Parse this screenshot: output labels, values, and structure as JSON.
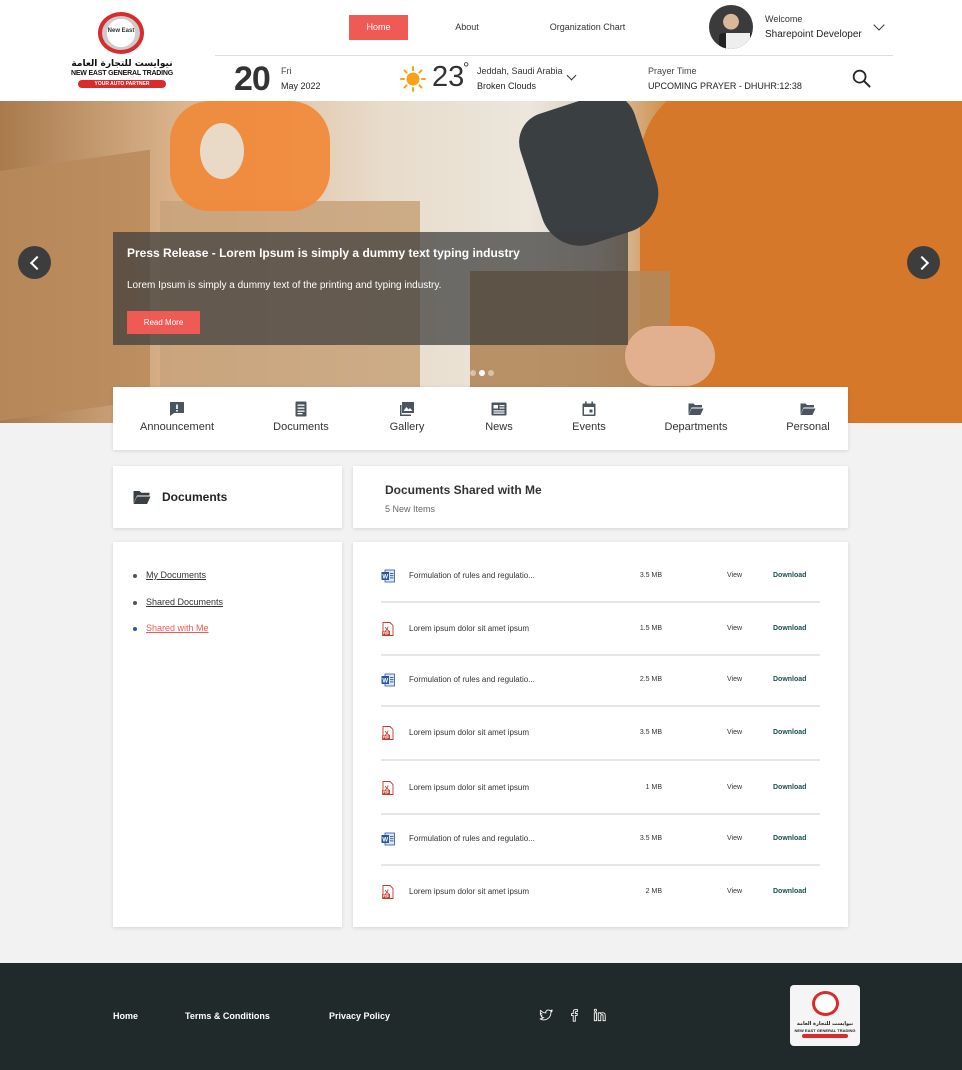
{
  "brand": {
    "arabic_name": "نيوايست للتجارة العامة",
    "english_name": "NEW EAST GENERAL TRADING",
    "tagline": "YOUR AUTO PARTNER",
    "emblem_text": "New East",
    "accent_color": "#ef5a55",
    "logo_red": "#d92b2b"
  },
  "nav": {
    "home": "Home",
    "about": "About",
    "org_chart": "Organization Chart"
  },
  "user": {
    "welcome": "Welcome",
    "name": "Sharepoint Developer"
  },
  "date": {
    "day_number": "20",
    "weekday": "Fri",
    "month_year": "May 2022"
  },
  "weather": {
    "temperature": "23",
    "degree_symbol": "°",
    "location": "Jeddah, Saudi Arabia",
    "condition": "Broken Clouds",
    "icon": "sun-icon"
  },
  "prayer": {
    "label": "Prayer Time",
    "value": "UPCOMING PRAYER - DHUHR:12:38"
  },
  "hero": {
    "title": "Press Release - Lorem Ipsum is simply a dummy text typing industry",
    "text": "Lorem Ipsum is simply a dummy text of the printing and typing industry.",
    "button": "Read More",
    "active_slide": 2,
    "slide_count": 3
  },
  "quick_links": [
    {
      "label": "Announcement",
      "icon": "announcement-icon"
    },
    {
      "label": "Documents",
      "icon": "document-icon"
    },
    {
      "label": "Gallery",
      "icon": "gallery-icon"
    },
    {
      "label": "News",
      "icon": "news-icon"
    },
    {
      "label": "Events",
      "icon": "calendar-icon"
    },
    {
      "label": "Departments",
      "icon": "folder-open-icon"
    },
    {
      "label": "Personal",
      "icon": "folder-open-icon"
    }
  ],
  "documents_panel": {
    "title": "Documents",
    "links": [
      "My Documents",
      "Shared Documents",
      "Shared with Me"
    ],
    "active_link": "Shared with Me"
  },
  "shared": {
    "title": "Documents Shared with Me",
    "subtitle": "5 New Items",
    "view_label": "View",
    "download_label": "Download",
    "files": [
      {
        "type": "word",
        "name": "Formulation of rules and regulatio...",
        "size": "3.5 MB"
      },
      {
        "type": "pdf",
        "name": "Lorem ipsum dolor sit amet ipsum",
        "size": "1.5 MB"
      },
      {
        "type": "word",
        "name": "Formulation of rules and regulatio...",
        "size": "2.5 MB"
      },
      {
        "type": "pdf",
        "name": "Lorem ipsum dolor sit amet ipsum",
        "size": "3.5 MB"
      },
      {
        "type": "pdf",
        "name": "Lorem ipsum dolor sit amet ipsum",
        "size": "1 MB"
      },
      {
        "type": "word",
        "name": "Formulation of rules and regulatio...",
        "size": "3.5 MB"
      },
      {
        "type": "pdf",
        "name": "Lorem ipsum dolor sit amet ipsum",
        "size": "2 MB"
      }
    ]
  },
  "footer": {
    "links": [
      "Home",
      "Terms & Conditions",
      "Privacy Policy"
    ],
    "social": [
      "twitter-icon",
      "facebook-icon",
      "linkedin-icon"
    ],
    "background": "#212a2a"
  }
}
